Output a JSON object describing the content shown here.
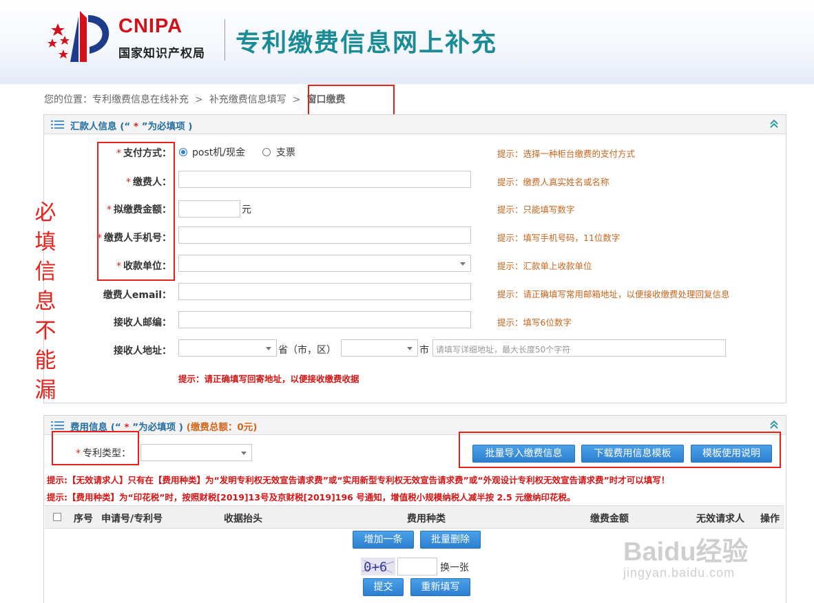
{
  "header": {
    "brand": "CNIPA",
    "brand_sub": "国家知识产权局",
    "site_title": "专利缴费信息网上补充"
  },
  "breadcrumb": {
    "prefix": "您的位置：",
    "items": [
      "专利缴费信息在线补充",
      "补充缴费信息填写",
      "窗口缴费"
    ],
    "separator": ">"
  },
  "remitter_panel": {
    "title_start": "汇款人信息 (“",
    "title_star": " * ",
    "title_end": "”为必填项 )",
    "fields": {
      "payment_method": {
        "label": "支付方式：",
        "options": [
          "post机/现金",
          "支票"
        ],
        "selected": "post机/现金",
        "hint": "提示：选择一种柜台缴费的支付方式"
      },
      "payer": {
        "label": "缴费人：",
        "value": "",
        "hint": "提示：缴费人真实姓名或名称"
      },
      "amount": {
        "label": "拟缴费金额：",
        "value": "",
        "unit": "元",
        "hint": "提示：只能填写数字"
      },
      "phone": {
        "label": "缴费人手机号：",
        "value": "",
        "hint": "提示：填写手机号码，11位数字"
      },
      "receiver_unit": {
        "label": "收款单位：",
        "value": "",
        "hint": "提示：汇款单上收款单位"
      },
      "email": {
        "label": "缴费人email：",
        "value": "",
        "hint": "提示：请正确填写常用邮箱地址，以便接收缴费处理回复信息"
      },
      "zip": {
        "label": "接收人邮编：",
        "value": "",
        "hint": "提示：填写6位数字"
      },
      "address": {
        "label": "接收人地址：",
        "province_suffix": "省（市，区）",
        "city_suffix": "市",
        "detail_placeholder": "请填写详细地址，最大长度50个字符"
      }
    },
    "address_note": "提示：请正确填写回寄地址，以便接收缴费收据"
  },
  "fee_panel": {
    "title_start": "费用信息 (“",
    "title_star": " * ",
    "title_end": "”为必填项 )",
    "total_label": "(缴费总额：0元)",
    "patent_type_label": "专利类型：",
    "patent_type_value": "",
    "buttons": {
      "batch_import": "批量导入缴费信息",
      "download_template": "下载费用信息模板",
      "template_help": "模板使用说明"
    },
    "notes": [
      "提示:【无效请求人】只有在【费用种类】为“发明专利权无效宣告请求费”或“实用新型专利权无效宣告请求费”或“外观设计专利权无效宣告请求费”时才可以填写！",
      "提示:【费用种类】为“印花税”时，按照财税[2019]13号及京财税[2019]196 号通知，增值税小规模纳税人减半按 2.5 元缴纳印花税。"
    ],
    "table_headers": [
      "序号",
      "申请号/专利号",
      "收据抬头",
      "费用种类",
      "缴费金额",
      "无效请求人",
      "操作"
    ],
    "add_row": "增加一条",
    "batch_delete": "批量删除",
    "captcha_text": "0+6",
    "captcha_refresh": "换一张",
    "submit": "提交",
    "reset": "重新填写"
  },
  "annotation": {
    "side_note": "必填信息不能漏"
  },
  "watermark": {
    "line1": "Baidu经验",
    "line2": "jingyan.baidu.com"
  },
  "colors": {
    "brand_red": "#d4111b",
    "title_teal": "#1b8c96",
    "panel_title": "#256fa3",
    "hint": "#c8651c",
    "button": "#2d7fd1",
    "annotation": "#e8201a"
  }
}
